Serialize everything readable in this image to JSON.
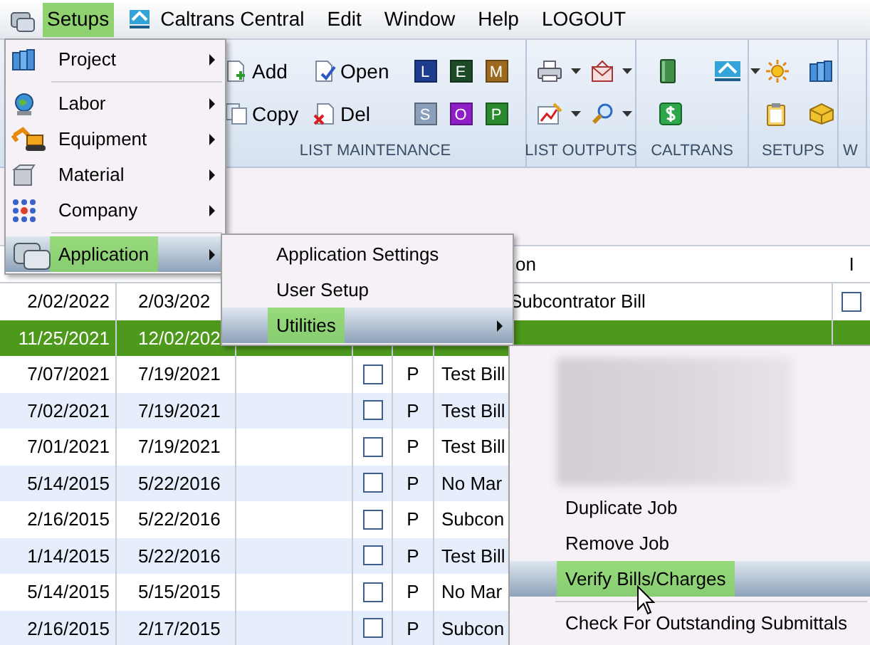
{
  "menu_bar": [
    {
      "label": "Setups",
      "selected": true
    },
    {
      "label": "Caltrans Central",
      "selected": false
    },
    {
      "label": "Edit",
      "selected": false
    },
    {
      "label": "Window",
      "selected": false
    },
    {
      "label": "Help",
      "selected": false
    },
    {
      "label": "LOGOUT",
      "selected": false
    }
  ],
  "ribbon": {
    "groups": [
      {
        "label": "LIST MAINTENANCE",
        "buttons": [
          {
            "kind": "text",
            "label": "Add"
          },
          {
            "kind": "text",
            "label": "Open"
          },
          {
            "kind": "letter",
            "label": "L",
            "color": "#1f3d8f"
          },
          {
            "kind": "letter",
            "label": "E",
            "color": "#1d4a28"
          },
          {
            "kind": "letter",
            "label": "M",
            "color": "#9b6a1e"
          },
          {
            "kind": "text",
            "label": "Copy"
          },
          {
            "kind": "text",
            "label": "Del"
          },
          {
            "kind": "letter",
            "label": "S",
            "color": "#8aa0bb"
          },
          {
            "kind": "letter",
            "label": "O",
            "color": "#8d1fc4"
          },
          {
            "kind": "letter",
            "label": "P",
            "color": "#2b8a2f"
          }
        ]
      },
      {
        "label": "LIST OUTPUTS",
        "buttons": [
          {
            "kind": "dropdown"
          },
          {
            "kind": "dropdown"
          },
          {
            "kind": "dropdown"
          },
          {
            "kind": "dropdown"
          }
        ]
      },
      {
        "label": "CALTRANS",
        "buttons": [
          {
            "kind": "icon"
          },
          {
            "kind": "dropdown"
          },
          {
            "kind": "icon"
          }
        ]
      },
      {
        "label": "SETUPS",
        "buttons": [
          {
            "kind": "icon"
          },
          {
            "kind": "icon"
          },
          {
            "kind": "icon"
          },
          {
            "kind": "icon"
          }
        ]
      },
      {
        "label": "W"
      }
    ]
  },
  "table": {
    "header": [
      "on",
      "I"
    ],
    "rows": [
      {
        "column_1": "2/02/2022",
        "column_2": "2/03/202",
        "column_6_tail": "Subcontrator Bill",
        "column_7_checked": false,
        "selected": false
      },
      {
        "column_1": "11/25/2021",
        "column_2": "12/02/202",
        "selected": true
      },
      {
        "column_1": "7/07/2021",
        "column_2": "7/19/2021",
        "checked": false,
        "column_5": "P",
        "column_6": "Test Bill",
        "selected": false
      },
      {
        "column_1": "7/02/2021",
        "column_2": "7/19/2021",
        "checked": false,
        "column_5": "P",
        "column_6": "Test Bill",
        "selected": false
      },
      {
        "column_1": "7/01/2021",
        "column_2": "7/19/2021",
        "checked": false,
        "column_5": "P",
        "column_6": "Test Bill",
        "selected": false
      },
      {
        "column_1": "5/14/2015",
        "column_2": "5/22/2016",
        "checked": false,
        "column_5": "P",
        "column_6": "No Mar",
        "selected": false
      },
      {
        "column_1": "2/16/2015",
        "column_2": "5/22/2016",
        "checked": false,
        "column_5": "P",
        "column_6": "Subcon",
        "selected": false
      },
      {
        "column_1": "1/14/2015",
        "column_2": "5/22/2016",
        "checked": false,
        "column_5": "P",
        "column_6": "Test Bill",
        "selected": false
      },
      {
        "column_1": "5/14/2015",
        "column_2": "5/15/2015",
        "checked": false,
        "column_5": "P",
        "column_6": "No Mar",
        "selected": false
      },
      {
        "column_1": "2/16/2015",
        "column_2": "2/17/2015",
        "checked": false,
        "column_5": "P",
        "column_6": "Subcon",
        "selected": false
      }
    ]
  },
  "setups_menu": {
    "items": [
      {
        "label": "Project",
        "selected": false,
        "has_submenu": true,
        "divider_below": true
      },
      {
        "label": "Labor",
        "selected": false,
        "has_submenu": true,
        "divider_below": false
      },
      {
        "label": "Equipment",
        "selected": false,
        "has_submenu": true,
        "divider_below": false
      },
      {
        "label": "Material",
        "selected": false,
        "has_submenu": true,
        "divider_below": false
      },
      {
        "label": "Company",
        "selected": false,
        "has_submenu": true,
        "divider_below": true
      },
      {
        "label": "Application",
        "selected": true,
        "has_submenu": true,
        "divider_below": false
      }
    ]
  },
  "application_menu": {
    "items": [
      {
        "label": "Application Settings",
        "selected": false,
        "has_submenu": false,
        "divider_below": false
      },
      {
        "label": "User Setup",
        "selected": false,
        "has_submenu": false,
        "divider_below": false
      },
      {
        "label": "Utilities",
        "selected": true,
        "has_submenu": true,
        "divider_below": false
      }
    ]
  },
  "utilities_menu": {
    "items": [
      {
        "label": "Duplicate Job",
        "selected": false,
        "has_submenu": false,
        "divider_below": false
      },
      {
        "label": "Remove Job",
        "selected": false,
        "has_submenu": false,
        "divider_below": false
      },
      {
        "label": "Verify Bills/Charges",
        "selected": true,
        "has_submenu": false,
        "divider_below": true
      },
      {
        "label": "Check For Outstanding Submittals",
        "selected": false,
        "has_submenu": false,
        "divider_below": false
      }
    ]
  }
}
